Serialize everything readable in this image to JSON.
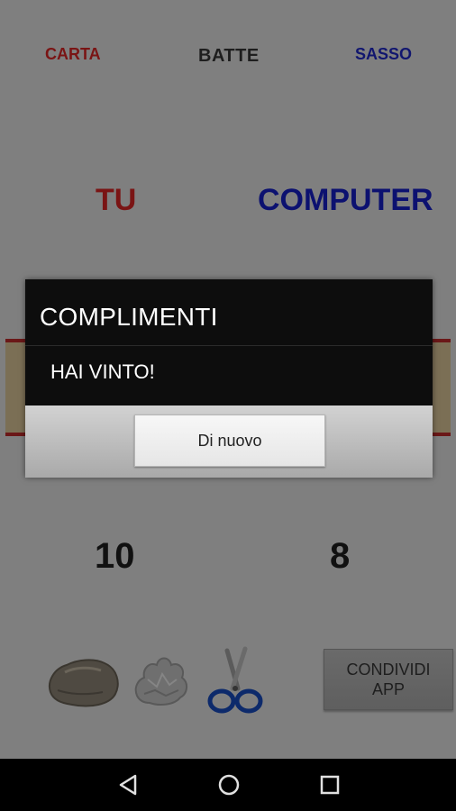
{
  "header": {
    "player_choice": "CARTA",
    "verb": "BATTE",
    "computer_choice": "SASSO"
  },
  "labels": {
    "you": "TU",
    "computer": "COMPUTER"
  },
  "scores": {
    "you": "10",
    "computer": "8"
  },
  "picks": [
    {
      "name": "rock-icon"
    },
    {
      "name": "paper-icon"
    },
    {
      "name": "scissors-icon"
    }
  ],
  "share": {
    "line1": "CONDIVIDI",
    "line2": "APP"
  },
  "dialog": {
    "title": "COMPLIMENTI",
    "message": "HAI VINTO!",
    "button": "Di nuovo"
  },
  "colors": {
    "player": "#c62828",
    "computer": "#1a237e",
    "dialog_bg": "#111111"
  },
  "navbar": {
    "icons": [
      "back-icon",
      "home-icon",
      "recents-icon"
    ]
  }
}
